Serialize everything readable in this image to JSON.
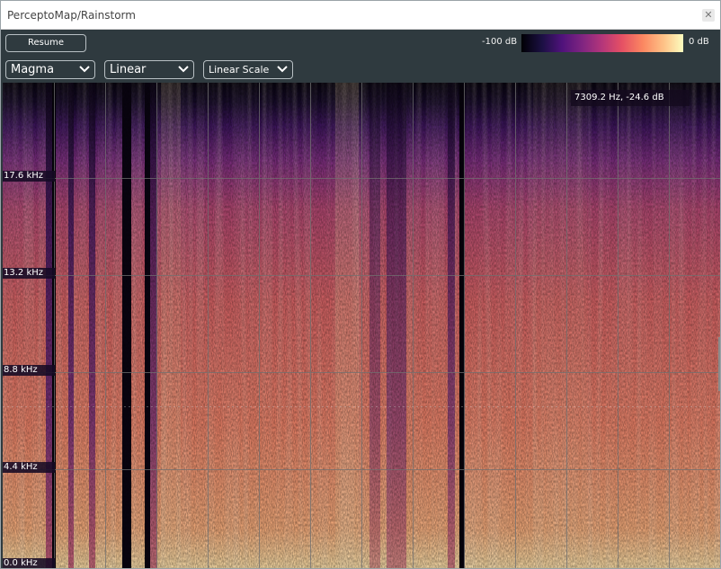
{
  "window": {
    "title": "PerceptoMap/Rainstorm",
    "close_glyph": "✕"
  },
  "toolbar": {
    "resume_label": "Resume",
    "colorbar_min": "-100 dB",
    "colorbar_max": "0 dB",
    "colormap": "Magma",
    "frequency_scale": "Linear",
    "amplitude_scale": "Linear Scale"
  },
  "readout": {
    "text": "7309.2 Hz, -24.6 dB"
  },
  "spectrogram": {
    "y_labels": [
      "17.6 kHz",
      "13.2 kHz",
      "8.8 kHz",
      "4.4 kHz",
      "0.0 kHz"
    ]
  },
  "icons": {
    "chevron": "chevron-down-icon",
    "close": "close-icon"
  },
  "colors": {
    "background": "#2f3a3f",
    "titlebar": "#ffffff",
    "grid": "#6f6f6f"
  }
}
